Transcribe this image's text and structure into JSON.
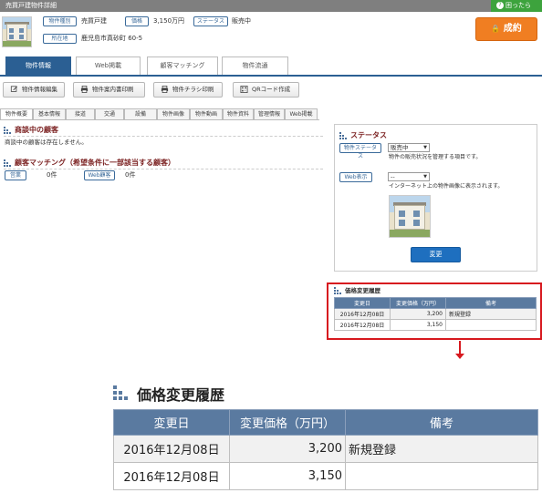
{
  "titlebar": {
    "title": "売買戸建物件詳細",
    "help": "困ったら"
  },
  "property": {
    "type_label": "物件種別",
    "type_value": "売買戸建",
    "price_label": "価格",
    "price_value": "3,150万円",
    "status_label": "ステータス",
    "status_value": "販売中",
    "address_label": "所在地",
    "address_value": "鹿児島市真砂町 60-5"
  },
  "seiyaku_button": "成約",
  "main_tabs": [
    "物件情報",
    "Web掲載",
    "顧客マッチング",
    "物件流通"
  ],
  "action_buttons": [
    "物件情報編集",
    "物件案内書印刷",
    "物件チラシ印刷",
    "QRコード作成"
  ],
  "sub_tabs": [
    "物件概要",
    "基本情報",
    "接道",
    "交通",
    "設備",
    "物件画像",
    "物件動画",
    "物件資料",
    "管理情報",
    "Web掲載"
  ],
  "negotiation": {
    "title": "商談中の顧客",
    "text": "商談中の顧客は存在しません。"
  },
  "matching": {
    "title": "顧客マッチング（希望条件に一部該当する顧客）",
    "sales_label": "営業",
    "sales_count": "0件",
    "web_label": "Web顧客",
    "web_count": "0件"
  },
  "status_panel": {
    "title": "ステータス",
    "status_label": "物件ステータス",
    "status_selected": "販売中",
    "status_help": "物件の販売状況を管理する項目です。",
    "web_label": "Web表示",
    "web_selected": "--",
    "web_help": "インターネット上の物件画像に表示されます。",
    "change_button": "変更"
  },
  "history": {
    "title": "価格変更履歴",
    "headers": [
      "変更日",
      "変更価格（万円）",
      "備考"
    ],
    "rows": [
      {
        "date": "2016年12月08日",
        "price": "3,200",
        "note": "新規登録"
      },
      {
        "date": "2016年12月08日",
        "price": "3,150",
        "note": ""
      }
    ]
  },
  "colors": {
    "accent": "#2b5f93",
    "orange": "#f07e22",
    "red": "#d7191f",
    "green": "#3da33d"
  }
}
